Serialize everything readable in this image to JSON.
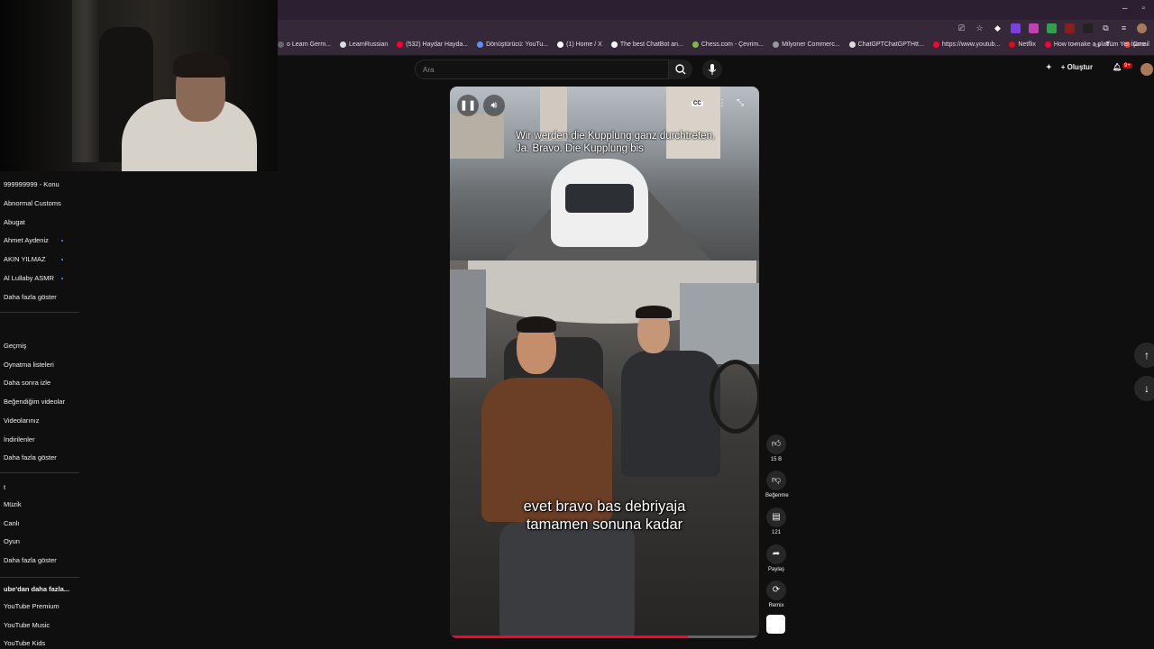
{
  "browser": {
    "window_controls": [
      "–",
      "▫"
    ],
    "bookmarks": [
      {
        "label": "o Learn Germ...",
        "color": "#666666"
      },
      {
        "label": "LearnRussian",
        "color": "#dddddd"
      },
      {
        "label": "(532) Haydar Hayda...",
        "color": "#ff0033"
      },
      {
        "label": "Dönüştürücü: YouTu...",
        "color": "#5b8ff9"
      },
      {
        "label": "(1) Home / X",
        "color": "#ffffff"
      },
      {
        "label": "The best ChatBot an...",
        "color": "#ffffff"
      },
      {
        "label": "Chess.com - Çevrim...",
        "color": "#81b64c"
      },
      {
        "label": "Milyoner Commerc...",
        "color": "#999999"
      },
      {
        "label": "ChatGPTChatGPTHtt...",
        "color": "#dddddd"
      },
      {
        "label": "https://www.youtub...",
        "color": "#ff0033"
      },
      {
        "label": "Netflix",
        "color": "#e50914"
      },
      {
        "label": "How to make a platf...",
        "color": "#ff0033"
      },
      {
        "label": "Gmail",
        "color": "#ea4335"
      }
    ],
    "bookmarks_overflow": "»",
    "all_bookmarks": "Tüm Yer İşare"
  },
  "header": {
    "search_placeholder": "Ara",
    "create_label": "Oluştur",
    "notification_count": "9+"
  },
  "sidebar": {
    "subscriptions": [
      {
        "label": "999999999 - Konu",
        "dot": false
      },
      {
        "label": "Abnormal Customs",
        "dot": false
      },
      {
        "label": "Abugat",
        "dot": false
      },
      {
        "label": "Ahmet Aydeniz",
        "dot": true
      },
      {
        "label": "AKIN YILMAZ",
        "dot": true
      },
      {
        "label": "Al Lullaby ASMR",
        "dot": true
      },
      {
        "label": "Daha fazla göster",
        "dot": false
      }
    ],
    "you_section": [
      "Geçmiş",
      "Oynatma listeleri",
      "Daha sonra izle",
      "Beğendiğim videolar",
      "Videolarınız",
      "İndirilenler",
      "Daha fazla göster"
    ],
    "explore_heading": "t",
    "explore": [
      "Müzik",
      "Canlı",
      "Oyun",
      "Daha fazla göster"
    ],
    "more_heading": "ube'dan daha fazla...",
    "more": [
      "YouTube Premium",
      "YouTube Music",
      "YouTube Kids"
    ]
  },
  "video": {
    "subtitle_top": [
      "Wir werden die Kupplung ganz durchtreten.",
      "Ja. Bravo. Die Kupplung bis"
    ],
    "subtitle_bottom": [
      "evet bravo bas debriyaja",
      "tamamen sonuna kadar"
    ],
    "cc_label": "CC",
    "progress": 0.77
  },
  "actions": {
    "like_count": "15 B",
    "dislike_label": "Beğenme",
    "comment_count": "121",
    "share_label": "Paylaş",
    "remix_label": "Remix"
  },
  "colors": {
    "accent": "#ff0033",
    "background": "#0f0f0f"
  }
}
